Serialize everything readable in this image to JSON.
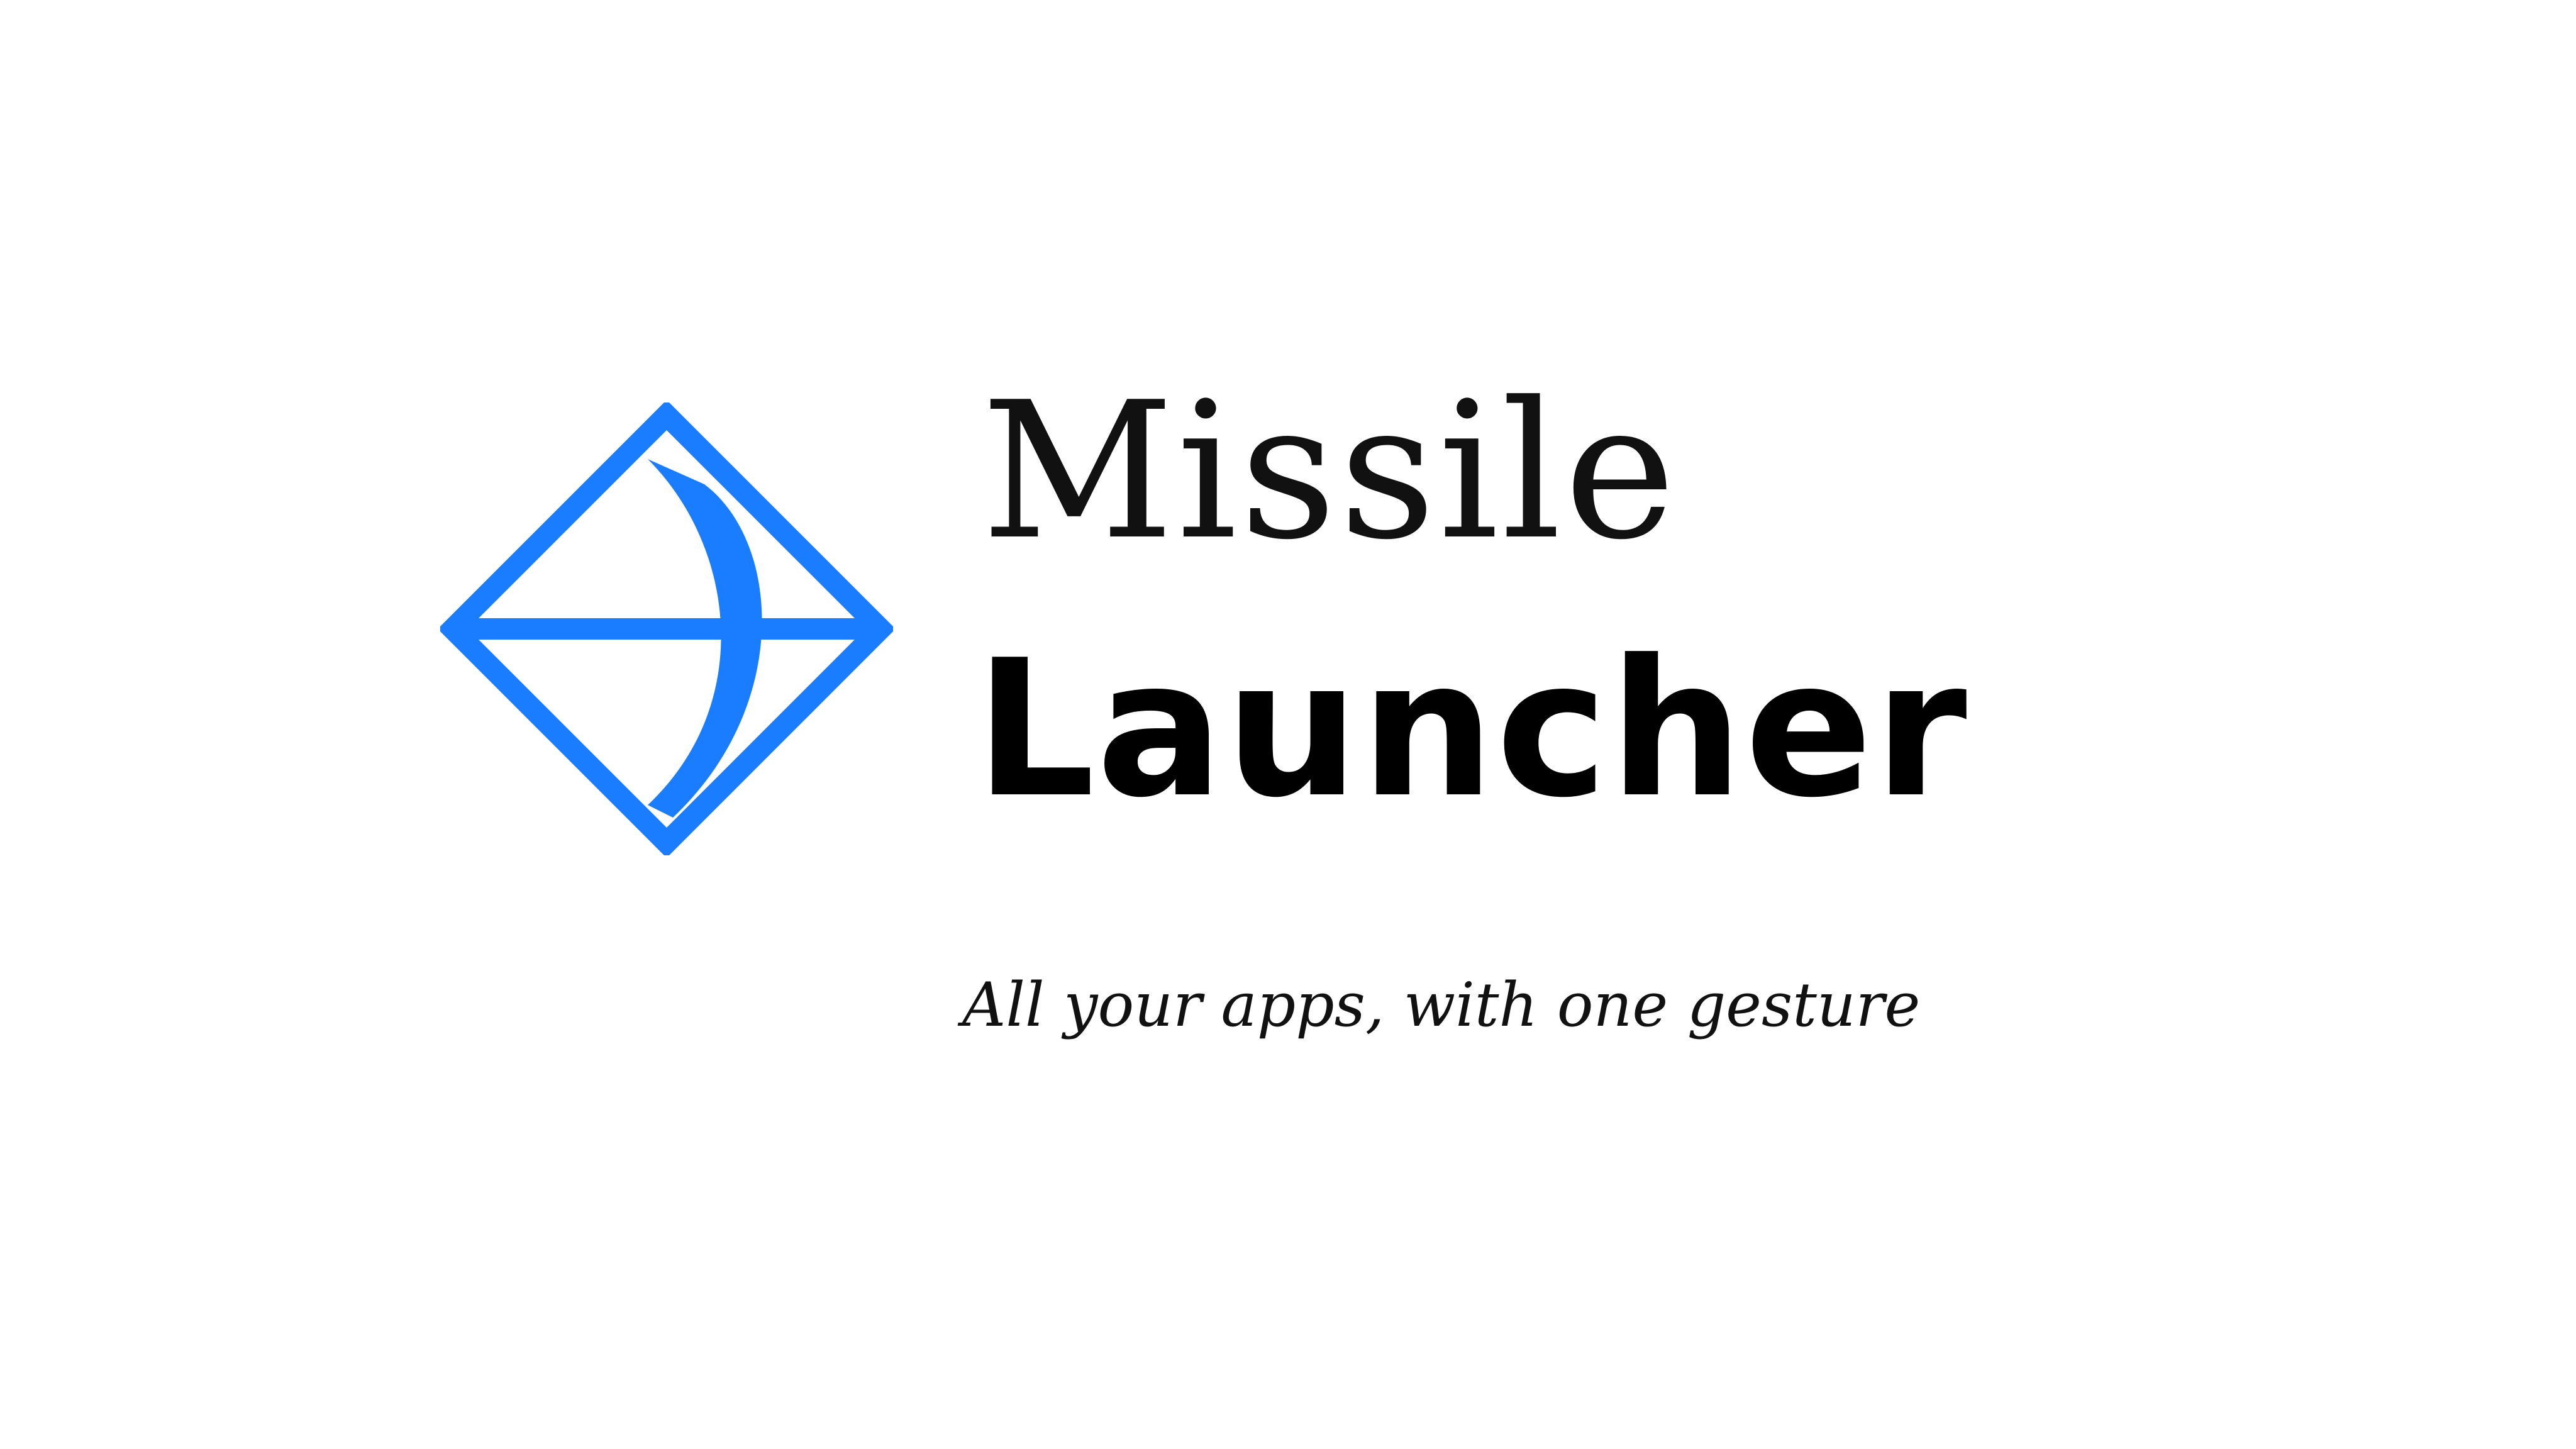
{
  "brand": {
    "name_line1": "Missile",
    "name_line2": "Launcher",
    "tagline": "All your apps, with one gesture",
    "accent_color": "#1a7cff",
    "logo_icon": "bow-and-arrow-diamond-icon"
  }
}
